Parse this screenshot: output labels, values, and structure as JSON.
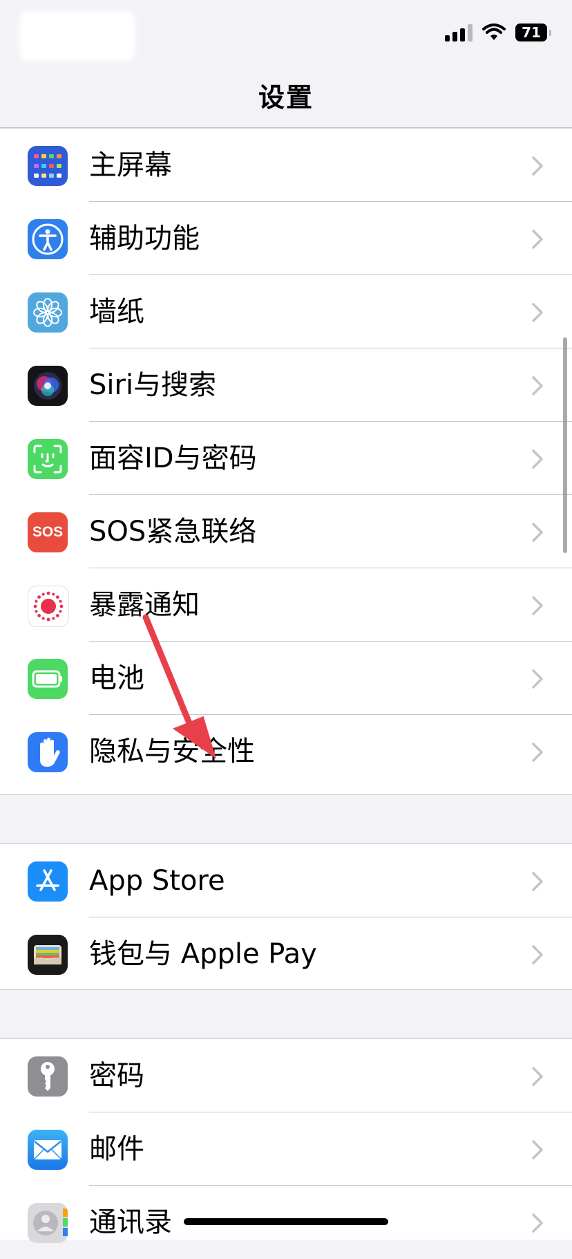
{
  "status_bar": {
    "battery_level": "71"
  },
  "nav": {
    "title": "设置"
  },
  "group1": [
    {
      "label": "主屏幕",
      "icon": "home-screen-icon"
    },
    {
      "label": "辅助功能",
      "icon": "accessibility-icon"
    },
    {
      "label": "墙纸",
      "icon": "wallpaper-icon"
    },
    {
      "label": "Siri与搜索",
      "icon": "siri-icon"
    },
    {
      "label": "面容ID与密码",
      "icon": "face-id-icon"
    },
    {
      "label": "SOS紧急联络",
      "icon": "sos-icon",
      "icon_text": "SOS"
    },
    {
      "label": "暴露通知",
      "icon": "exposure-notification-icon"
    },
    {
      "label": "电池",
      "icon": "battery-icon"
    },
    {
      "label": "隐私与安全性",
      "icon": "privacy-hand-icon"
    }
  ],
  "group2": [
    {
      "label": "App Store",
      "icon": "app-store-icon"
    },
    {
      "label": "钱包与 Apple Pay",
      "icon": "wallet-icon"
    }
  ],
  "group3": [
    {
      "label": "密码",
      "icon": "key-icon"
    },
    {
      "label": "邮件",
      "icon": "mail-icon"
    },
    {
      "label": "通讯录",
      "icon": "contacts-icon"
    }
  ],
  "colors": {
    "background": "#f2f2f7",
    "row_background": "#ffffff",
    "separator": "#c6c6c8",
    "chevron": "#c4c4c6",
    "annotation_arrow": "#e8404a"
  }
}
